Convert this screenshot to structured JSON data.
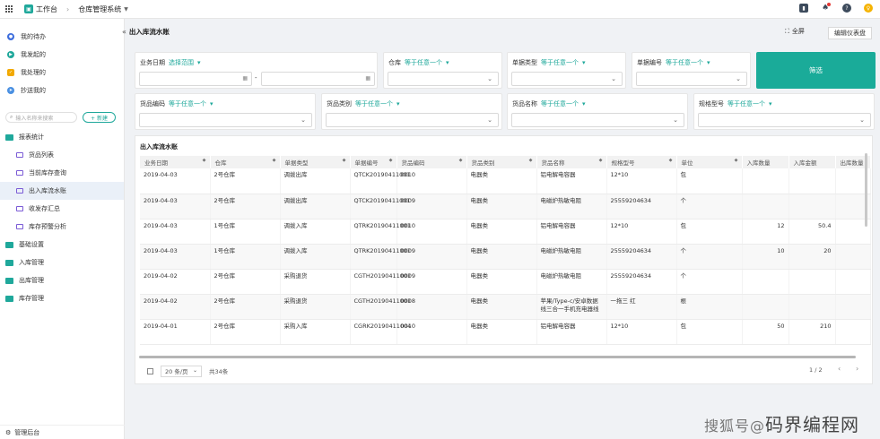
{
  "topbar": {
    "app_title": "工作台",
    "crumb": "仓库管理系统"
  },
  "sidebar": {
    "quick": [
      {
        "label": "我的待办",
        "icon": "bell-icon",
        "color": "#3d6ddd"
      },
      {
        "label": "我发起的",
        "icon": "send-icon",
        "color": "#1fa89b"
      },
      {
        "label": "我处理的",
        "icon": "check-icon",
        "color": "#f2a900"
      },
      {
        "label": "抄送我的",
        "icon": "share-icon",
        "color": "#4a90e2"
      }
    ],
    "search_placeholder": "输入名称来搜索",
    "new_label": "+ 新建",
    "report_group": "报表统计",
    "reports": [
      "货品列表",
      "当前库存查询",
      "出入库流水账",
      "收发存汇总",
      "库存预警分析"
    ],
    "groups": [
      "基础设置",
      "入库管理",
      "出库管理",
      "库存管理"
    ],
    "footer": "管理后台"
  },
  "header": {
    "title": "出入库流水账",
    "fullscreen_label": "全屏",
    "edit_label": "编辑仪表盘"
  },
  "filters": {
    "date_label": "业务日期",
    "date_cond": "选择范围",
    "warehouse_label": "仓库",
    "warehouse_cond": "等于任意一个",
    "doctype_label": "单据类型",
    "doctype_cond": "等于任意一个",
    "docno_label": "单据编号",
    "docno_cond": "等于任意一个",
    "code_label": "货品编码",
    "code_cond": "等于任意一个",
    "category_label": "货品类别",
    "category_cond": "等于任意一个",
    "name_label": "货品名称",
    "name_cond": "等于任意一个",
    "spec_label": "规格型号",
    "spec_cond": "等于任意一个",
    "filter_button": "筛选",
    "date_sep": "-"
  },
  "table": {
    "title": "出入库流水账",
    "columns": [
      "业务日期",
      "仓库",
      "单据类型",
      "单据编号",
      "货品编码",
      "货品类别",
      "货品名称",
      "规格型号",
      "单位",
      "入库数量",
      "入库金额",
      "出库数量"
    ],
    "rows": [
      [
        "2019-04-03",
        "2号仓库",
        "调拨出库",
        "QTCK20190411001",
        "0010",
        "电器类",
        "铝电解电容器",
        "12*10",
        "包",
        "",
        "",
        ""
      ],
      [
        "2019-04-03",
        "2号仓库",
        "调拨出库",
        "QTCK20190411001",
        "0009",
        "电器类",
        "电磁炉热敏电阻",
        "25559204634",
        "个",
        "",
        "",
        ""
      ],
      [
        "2019-04-03",
        "1号仓库",
        "调拨入库",
        "QTRK20190411001",
        "0010",
        "电器类",
        "铝电解电容器",
        "12*10",
        "包",
        "12",
        "50.4",
        ""
      ],
      [
        "2019-04-03",
        "1号仓库",
        "调拨入库",
        "QTRK20190411001",
        "0009",
        "电器类",
        "电磁炉热敏电阻",
        "25559204634",
        "个",
        "10",
        "20",
        ""
      ],
      [
        "2019-04-02",
        "2号仓库",
        "采购退货",
        "CGTH20190411001",
        "0009",
        "电器类",
        "电磁炉热敏电阻",
        "25559204634",
        "个",
        "",
        "",
        ""
      ],
      [
        "2019-04-02",
        "2号仓库",
        "采购退货",
        "CGTH20190411001",
        "0008",
        "电器类",
        "苹果/Type-c/安卓数据线三合一手机充电器线",
        "一拖三 红",
        "根",
        "",
        "",
        ""
      ],
      [
        "2019-04-01",
        "2号仓库",
        "采购入库",
        "CGRK20190411004",
        "0010",
        "电器类",
        "铝电解电容器",
        "12*10",
        "包",
        "50",
        "210",
        ""
      ]
    ]
  },
  "pager": {
    "size": "20 条/页",
    "total": "共34条",
    "page": "1",
    "of": "/ 2"
  },
  "watermark": {
    "text": "码界编程网",
    "prefix": "搜狐号@"
  }
}
